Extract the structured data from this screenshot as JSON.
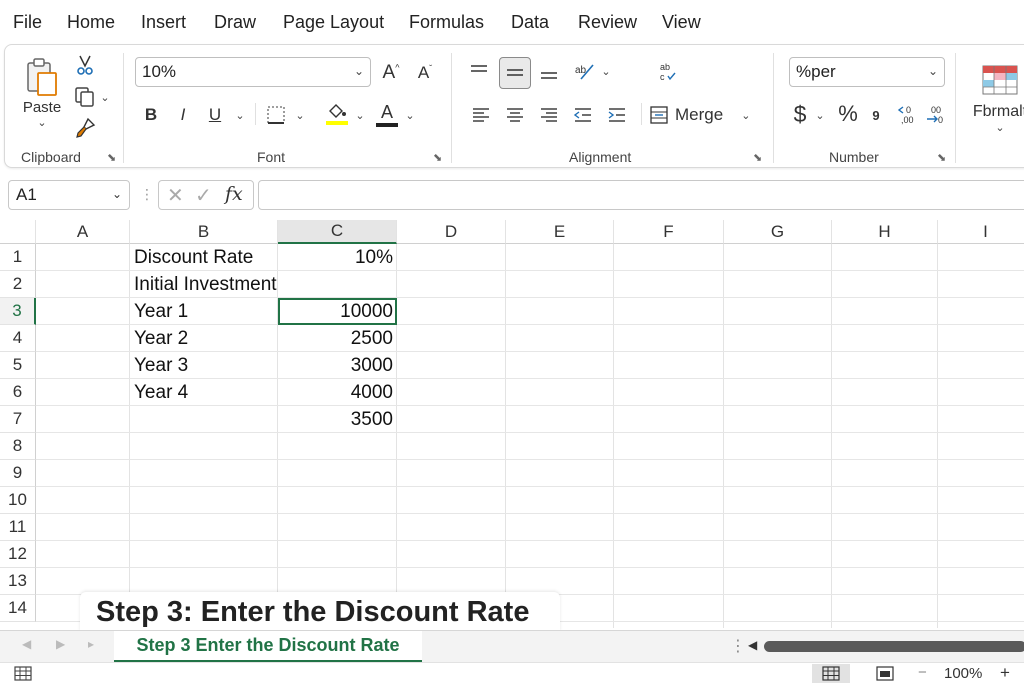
{
  "menu": [
    "File",
    "Home",
    "Insert",
    "Draw",
    "Page Layout",
    "Formulas",
    "Data",
    "Review",
    "View"
  ],
  "ribbon": {
    "clipboard": {
      "paste_label": "Paste",
      "group_label": "Clipboard"
    },
    "font": {
      "font_size": "10%",
      "bold": "B",
      "italic": "I",
      "underline": "U",
      "group_label": "Font"
    },
    "alignment": {
      "merge_label": "Merge",
      "group_label": "Alignment"
    },
    "number": {
      "format_value": "%per",
      "currency": "$",
      "percent": "%",
      "comma": "9",
      "group_label": "Number"
    },
    "styles": {
      "format_label": "Fbrmalt"
    }
  },
  "formula_bar": {
    "name_box": "A1",
    "fx_label": "fx",
    "formula": ""
  },
  "columns": [
    "A",
    "B",
    "C",
    "D",
    "E",
    "F",
    "G",
    "H",
    "I"
  ],
  "rows": [
    "1",
    "2",
    "3",
    "4",
    "5",
    "6",
    "7",
    "8",
    "9",
    "10",
    "11",
    "12",
    "13",
    "14"
  ],
  "cells": {
    "B1": "Discount Rate",
    "C1": "10%",
    "B2": "Initial Investment",
    "B3": "Year 1",
    "C3": "10000",
    "B4": "Year 2",
    "C4": "2500",
    "B5": "Year 3",
    "C5": "3000",
    "B6": "Year 4",
    "C6": "4000",
    "C7": "3500"
  },
  "caption": "Step 3: Enter the Discount  Rate",
  "sheet_tab": "Step 3 Enter the Discount Rate",
  "status": {
    "zoom": "100%",
    "minus": "−",
    "plus": "+"
  },
  "colors": {
    "accent": "#217346",
    "highlight": "#ffff00",
    "font_color": "#c00000"
  }
}
